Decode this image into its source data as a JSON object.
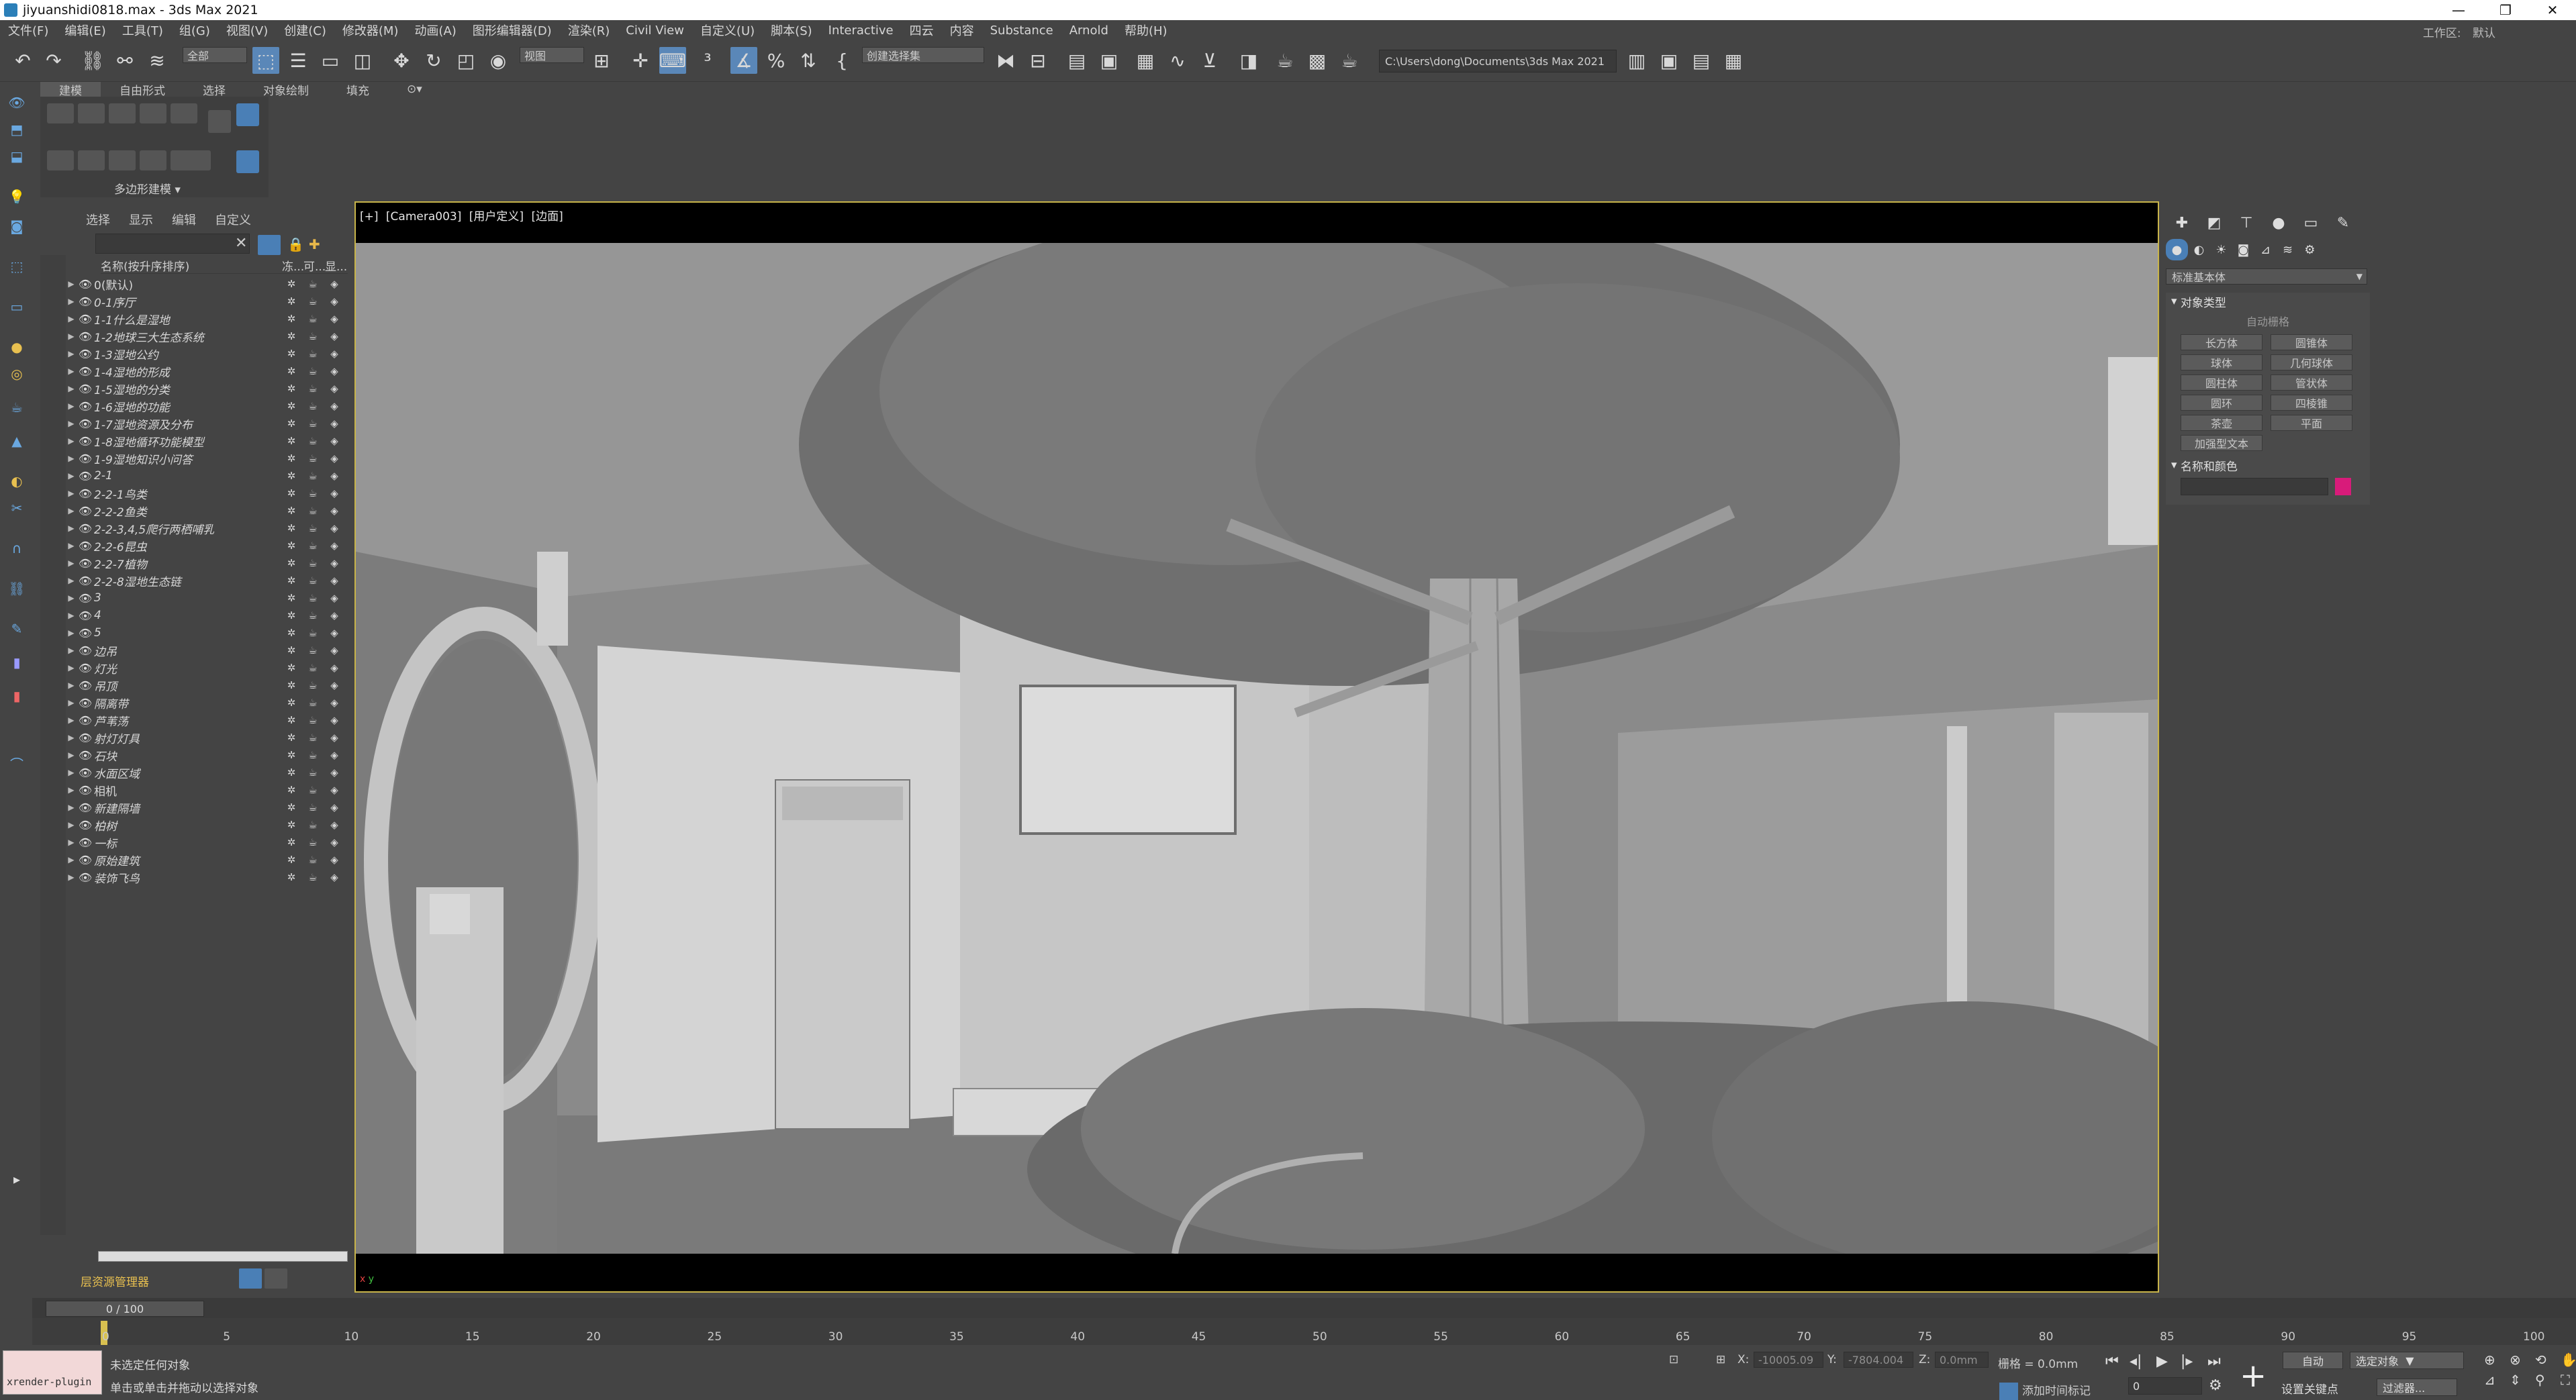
{
  "window": {
    "title": "jiyuanshidi0818.max - 3ds Max 2021",
    "controls": [
      "—",
      "❐",
      "✕"
    ]
  },
  "menu": {
    "items": [
      "文件(F)",
      "编辑(E)",
      "工具(T)",
      "组(G)",
      "视图(V)",
      "创建(C)",
      "修改器(M)",
      "动画(A)",
      "图形编辑器(D)",
      "渲染(R)",
      "Civil View",
      "自定义(U)",
      "脚本(S)",
      "Interactive",
      "四云",
      "内容",
      "Substance",
      "Arnold",
      "帮助(H)"
    ],
    "workspace_label": "工作区:",
    "workspace_value": "默认"
  },
  "toolbar": {
    "selection_filter": "全部",
    "ref_coord": "视图",
    "named_selection": "创建选择集",
    "project_path": "C:\\Users\\dong\\Documents\\3ds Max 2021"
  },
  "ribbon": {
    "tabs": [
      "建模",
      "自由形式",
      "选择",
      "对象绘制",
      "填充"
    ],
    "panel_label": "多边形建模"
  },
  "scene_explorer": {
    "menu": [
      "选择",
      "显示",
      "编辑",
      "自定义"
    ],
    "column_name": "名称(按升序排序)",
    "column_frozen": "冻...",
    "column_render": "可...",
    "column_display": "显...",
    "rows": [
      {
        "name": "0(默认)",
        "plain": true
      },
      {
        "name": "0-1序厅",
        "plain": false
      },
      {
        "name": "1-1什么是湿地",
        "plain": false
      },
      {
        "name": "1-2地球三大生态系统",
        "plain": false
      },
      {
        "name": "1-3湿地公约",
        "plain": false
      },
      {
        "name": "1-4湿地的形成",
        "plain": false
      },
      {
        "name": "1-5湿地的分类",
        "plain": false
      },
      {
        "name": "1-6湿地的功能",
        "plain": false
      },
      {
        "name": "1-7湿地资源及分布",
        "plain": false
      },
      {
        "name": "1-8湿地循环功能模型",
        "plain": false
      },
      {
        "name": "1-9湿地知识小问答",
        "plain": false
      },
      {
        "name": "2-1",
        "plain": false
      },
      {
        "name": "2-2-1鸟类",
        "plain": false
      },
      {
        "name": "2-2-2鱼类",
        "plain": false
      },
      {
        "name": "2-2-3,4,5爬行两栖哺乳",
        "plain": false
      },
      {
        "name": "2-2-6昆虫",
        "plain": false
      },
      {
        "name": "2-2-7植物",
        "plain": false
      },
      {
        "name": "2-2-8湿地生态链",
        "plain": false
      },
      {
        "name": "3",
        "plain": false
      },
      {
        "name": "4",
        "plain": false
      },
      {
        "name": "5",
        "plain": false
      },
      {
        "name": "边吊",
        "plain": false
      },
      {
        "name": "灯光",
        "plain": false
      },
      {
        "name": "吊顶",
        "plain": false
      },
      {
        "name": "隔离带",
        "plain": false
      },
      {
        "name": "芦苇荡",
        "plain": false
      },
      {
        "name": "射灯灯具",
        "plain": false
      },
      {
        "name": "石块",
        "plain": false
      },
      {
        "name": "水面区域",
        "plain": false
      },
      {
        "name": "相机",
        "plain": true
      },
      {
        "name": "新建隔墙",
        "plain": false
      },
      {
        "name": "柏树",
        "plain": false
      },
      {
        "name": "一标",
        "plain": false
      },
      {
        "name": "原始建筑",
        "plain": false
      },
      {
        "name": "装饰飞鸟",
        "plain": false
      }
    ],
    "footer_label": "层资源管理器"
  },
  "viewport": {
    "labels": [
      "[+]",
      "[Camera003]",
      "[用户定义]",
      "[边面]"
    ],
    "axis_x": "x",
    "axis_y": "y"
  },
  "command_panel": {
    "category": "标准基本体",
    "object_type_title": "对象类型",
    "autogrid": "自动栅格",
    "primitives": [
      "长方体",
      "圆锥体",
      "球体",
      "几何球体",
      "圆柱体",
      "管状体",
      "圆环",
      "四棱锥",
      "茶壶",
      "平面",
      "加强型文本"
    ],
    "name_color_title": "名称和颜色",
    "object_color": "#d81b7a"
  },
  "timeline": {
    "slider_text": "0 / 100",
    "ticks": [
      "0",
      "5",
      "10",
      "15",
      "20",
      "25",
      "30",
      "35",
      "40",
      "45",
      "50",
      "55",
      "60",
      "65",
      "70",
      "75",
      "80",
      "85",
      "90",
      "95",
      "100"
    ]
  },
  "status": {
    "script_text": "xrender-plugin",
    "line1": "未选定任何对象",
    "line2": "单击或单击并拖动以选择对象",
    "x_label": "X:",
    "x_value": "-10005.09",
    "y_label": "Y:",
    "y_value": "-7804.004",
    "z_label": "Z:",
    "z_value": "0.0mm",
    "grid": "栅格 = 0.0mm",
    "add_time_tag": "添加时间标记",
    "auto_key": "自动",
    "selected_obj": "选定对象",
    "set_key": "设置关键点",
    "filters": "过滤器...",
    "current_frame": "0"
  }
}
